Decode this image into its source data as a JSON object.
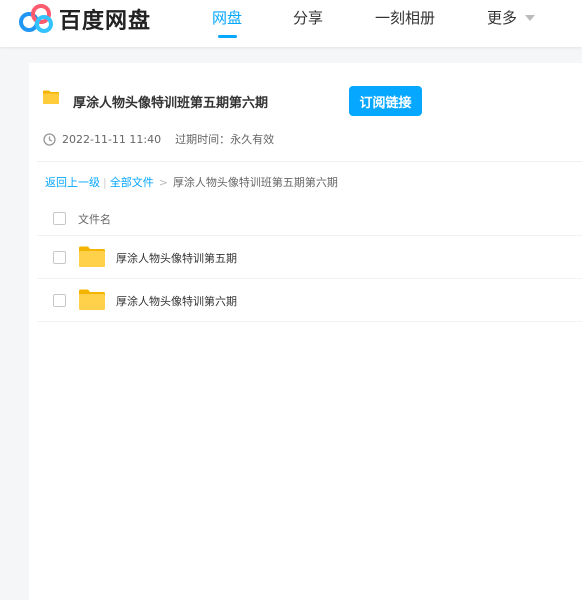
{
  "header": {
    "logo_text": "百度网盘",
    "nav": [
      {
        "label": "网盘",
        "active": true
      },
      {
        "label": "分享",
        "active": false
      },
      {
        "label": "一刻相册",
        "active": false
      },
      {
        "label": "更多",
        "active": false
      }
    ],
    "accent_color": "#06a7ff"
  },
  "share": {
    "title": "厚涂人物头像特训班第五期第六期",
    "subscribe_label": "订阅链接",
    "time": "2022-11-11 11:40",
    "expire_label": "过期时间：永久有效"
  },
  "breadcrumb": {
    "back": "返回上一级",
    "sep": "|",
    "all_files": "全部文件",
    "arrow": ">",
    "current": "厚涂人物头像特训班第五期第六期"
  },
  "table": {
    "header": "文件名",
    "rows": [
      {
        "name": "厚涂人物头像特训第五期",
        "icon": "folder-icon"
      },
      {
        "name": "厚涂人物头像特训第六期",
        "icon": "folder-icon"
      }
    ]
  }
}
